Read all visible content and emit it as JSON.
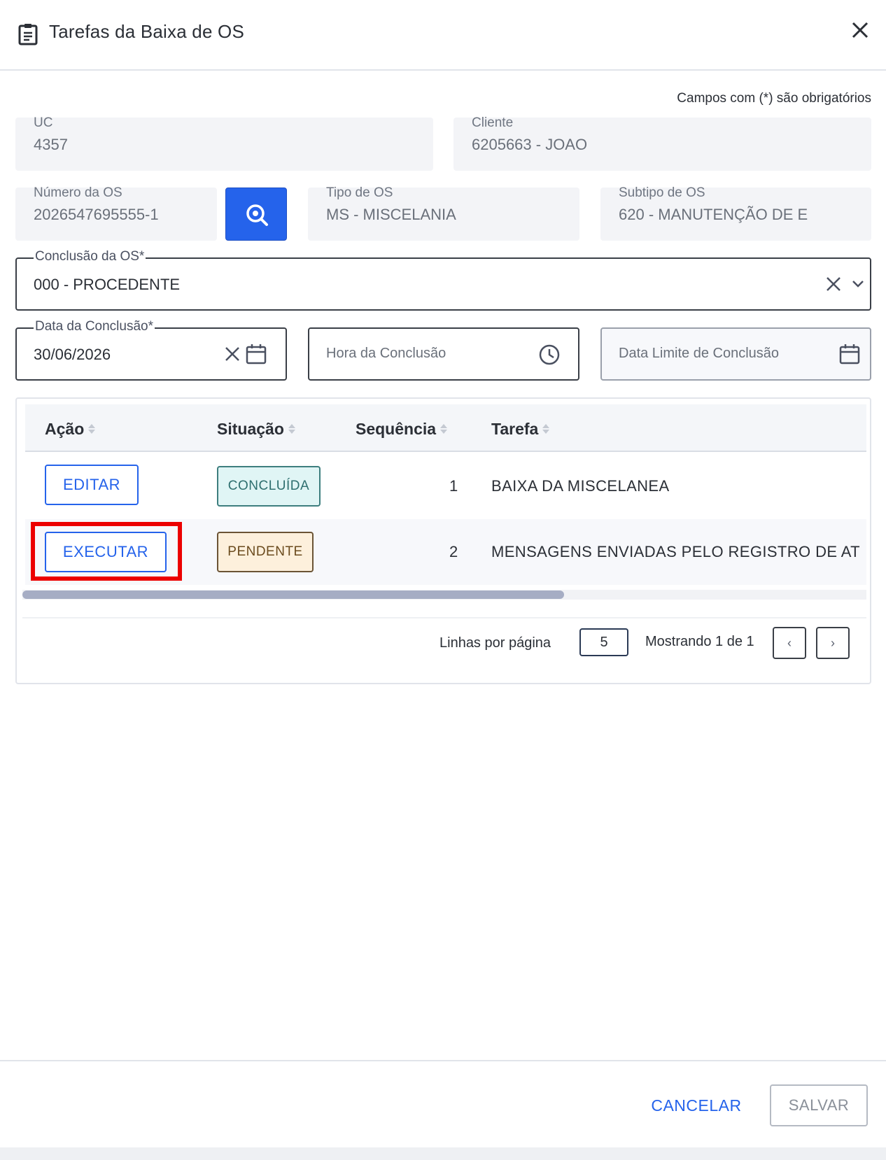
{
  "dialog": {
    "title": "Tarefas da Baixa de OS",
    "required_note": "Campos com (*) são obrigatórios"
  },
  "fields": {
    "uc": {
      "label": "UC",
      "value": "4357"
    },
    "cliente": {
      "label": "Cliente",
      "value": "6205663 - JOAO"
    },
    "numero_os": {
      "label": "Número da OS",
      "value": "2026547695555-1"
    },
    "tipo_os": {
      "label": "Tipo de OS",
      "value": "MS - MISCELANIA"
    },
    "subtipo_os": {
      "label": "Subtipo de OS",
      "value": "620 -  MANUTENÇÃO DE E"
    },
    "conclusao_os": {
      "label": "Conclusão da OS*",
      "value": "000 - PROCEDENTE"
    },
    "data_conclusao": {
      "label": "Data da Conclusão*",
      "value": "30/06/2026"
    },
    "hora_conclusao": {
      "placeholder": "Hora da Conclusão"
    },
    "data_limite": {
      "placeholder": "Data Limite de Conclusão"
    }
  },
  "table": {
    "headers": [
      "Ação",
      "Situação",
      "Sequência",
      "Tarefa"
    ],
    "rows": [
      {
        "action": "EDITAR",
        "status": "CONCLUÍDA",
        "status_kind": "done",
        "sequence": "1",
        "task": "BAIXA DA MISCELANEA"
      },
      {
        "action": "EXECUTAR",
        "status": "PENDENTE",
        "status_kind": "pending",
        "sequence": "2",
        "task": "MENSAGENS ENVIADAS PELO REGISTRO DE AT"
      }
    ]
  },
  "pager": {
    "rows_per_page_label": "Linhas por página",
    "rows_per_page": "5",
    "showing": "Mostrando 1 de 1",
    "prev": "‹",
    "next": "›"
  },
  "footer": {
    "cancel": "CANCELAR",
    "save": "SALVAR"
  },
  "colors": {
    "primary": "#2563eb",
    "highlight": "#ec0000",
    "done_bg": "#e0f5f5",
    "pending_bg": "#fdf0dc"
  },
  "icons": {
    "title": "clipboard-icon",
    "close": "close-icon",
    "search": "search-icon",
    "clear": "clear-icon",
    "dropdown": "chevron-down-icon",
    "calendar": "calendar-icon",
    "clock": "clock-icon"
  }
}
